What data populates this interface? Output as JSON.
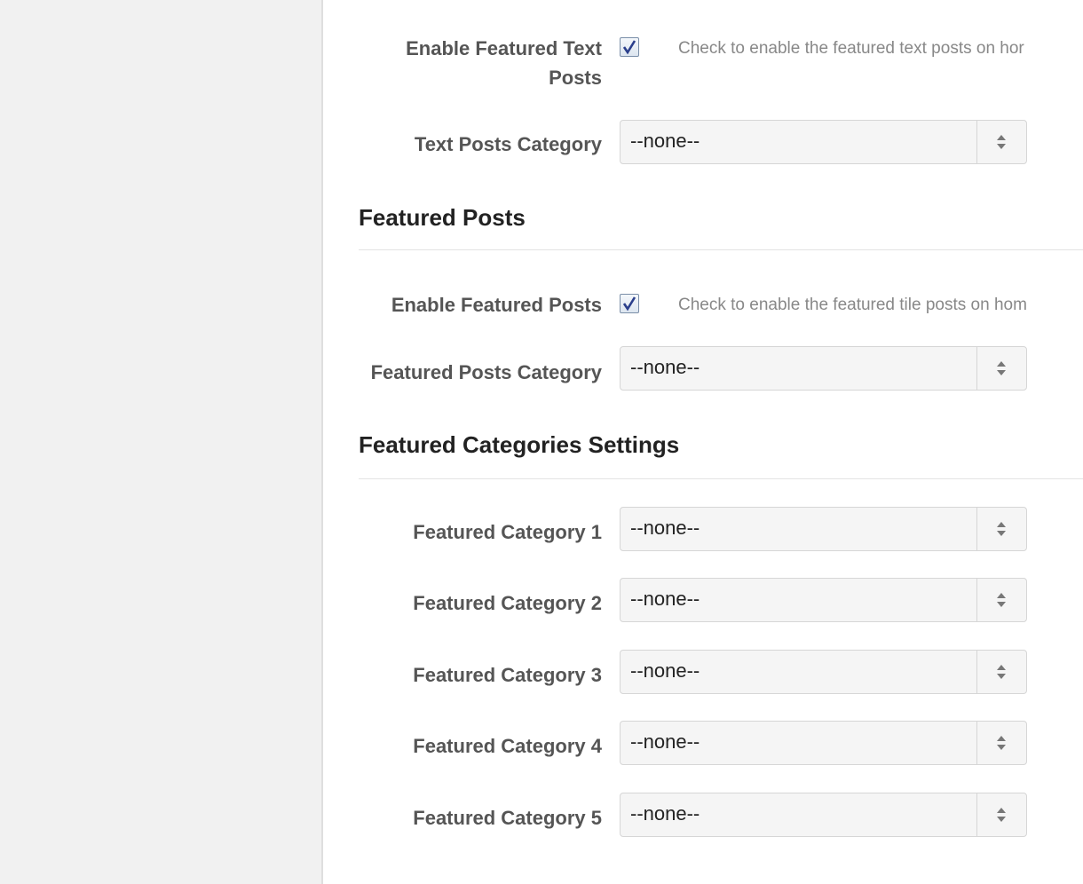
{
  "text_posts": {
    "enable_label_line1": "Enable Featured Text",
    "enable_label_line2": "Posts",
    "enable_checked": true,
    "enable_description": "Check to enable the featured text posts on hor",
    "category_label": "Text Posts Category",
    "category_value": "--none--"
  },
  "featured_posts": {
    "section_title": "Featured Posts",
    "enable_label": "Enable Featured Posts",
    "enable_checked": true,
    "enable_description": "Check to enable the featured tile posts on hom",
    "category_label": "Featured Posts Category",
    "category_value": "--none--"
  },
  "featured_categories": {
    "section_title": "Featured Categories Settings",
    "items": [
      {
        "label": "Featured Category 1",
        "value": "--none--"
      },
      {
        "label": "Featured Category 2",
        "value": "--none--"
      },
      {
        "label": "Featured Category 3",
        "value": "--none--"
      },
      {
        "label": "Featured Category 4",
        "value": "--none--"
      },
      {
        "label": "Featured Category 5",
        "value": "--none--"
      }
    ]
  },
  "icons": {
    "checkbox_check": "check-icon",
    "select_arrows": "sort-arrows-icon"
  },
  "colors": {
    "check": "#2b3f8c",
    "label": "#555555",
    "description": "#888888",
    "sidebar_bg": "#f1f1f1"
  }
}
